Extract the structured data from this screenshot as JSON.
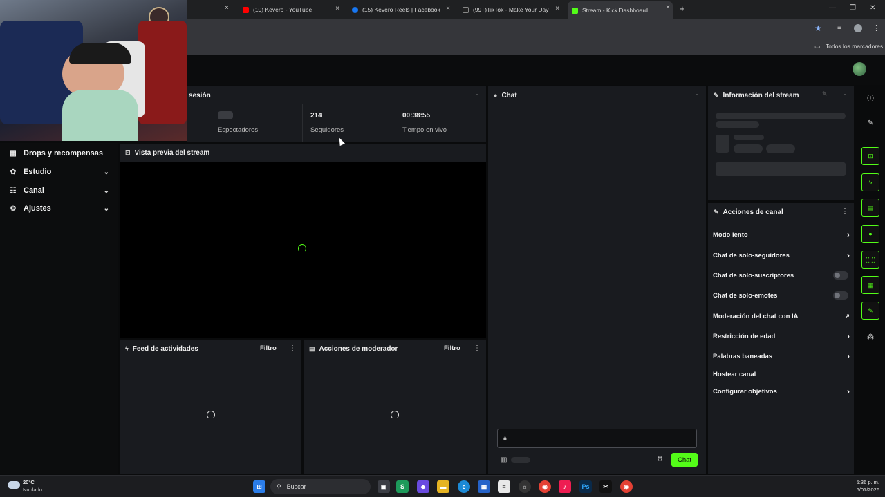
{
  "browser": {
    "tabs": [
      {
        "label": "(10) Kevero - YouTube",
        "color": "#ff0000"
      },
      {
        "label": "(15) Kevero Reels | Facebook",
        "color": "#1877f2"
      },
      {
        "label": "(99+)TikTok - Make Your Day",
        "color": "#111111"
      },
      {
        "label": "Stream - Kick Dashboard",
        "color": "#53fc18"
      }
    ],
    "new_tab": "+",
    "close_glyph": "×",
    "bookmarks_folder": "Todos los marcadores"
  },
  "session": {
    "title_partial": "sesión",
    "stats": [
      {
        "value": "",
        "label": "Espectadores"
      },
      {
        "value": "214",
        "label": "Seguidores"
      },
      {
        "value": "00:38:55",
        "label": "Tiempo en vivo"
      }
    ]
  },
  "sidebar": {
    "items": [
      {
        "label": "Drops y recompensas",
        "icon": "gift-icon",
        "glyph": "▦"
      },
      {
        "label": "Estudio",
        "icon": "studio-icon",
        "glyph": "✿"
      },
      {
        "label": "Canal",
        "icon": "users-icon",
        "glyph": "☷"
      },
      {
        "label": "Ajustes",
        "icon": "gear-icon",
        "glyph": "⚙"
      }
    ]
  },
  "preview": {
    "title": "Vista previa del stream"
  },
  "feed": {
    "title": "Feed de actividades",
    "filter": "Filtro"
  },
  "modactions": {
    "title": "Acciones de moderador",
    "filter": "Filtro"
  },
  "chat": {
    "title": "Chat",
    "send_label": "Chat",
    "accent": "#53fc18"
  },
  "streaminfo": {
    "title": "Información del stream"
  },
  "channel_actions": {
    "title": "Acciones de canal",
    "items": [
      {
        "label": "Modo lento",
        "control": "arrow"
      },
      {
        "label": "Chat de solo-seguidores",
        "control": "arrow"
      },
      {
        "label": "Chat de solo-suscriptores",
        "control": "toggle"
      },
      {
        "label": "Chat de solo-emotes",
        "control": "toggle"
      },
      {
        "label": "Moderación del chat con IA",
        "control": "external"
      },
      {
        "label": "Restricción de edad",
        "control": "arrow"
      },
      {
        "label": "Palabras baneadas",
        "control": "arrow"
      },
      {
        "label": "Hostear canal",
        "control": "none"
      },
      {
        "label": "Configurar objetivos",
        "control": "arrow"
      }
    ]
  },
  "taskbar": {
    "weather_temp": "20°C",
    "weather_desc": "Nublado",
    "search_label": "Buscar",
    "time": "5:36 p. m.",
    "date": "6/01/2026"
  }
}
